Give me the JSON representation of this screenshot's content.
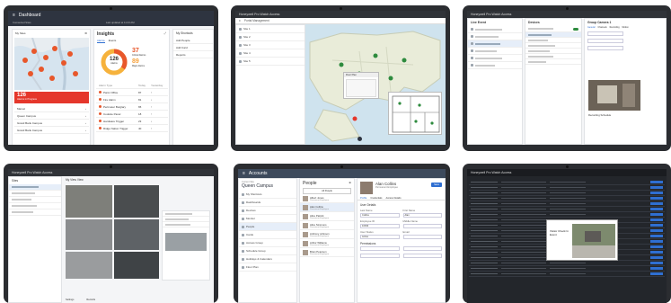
{
  "tablet1": {
    "header_title": "Dashboard",
    "header_sub_left": "Connected Sites",
    "header_sub_center": "Last updated at 11:23 AM",
    "map_title": "My Sites",
    "alert_count": "126",
    "alert_label": "Alarms in Progress",
    "sites": [
      "Marvel",
      "Queen Campus",
      "Grand Bank Campus",
      "Grand Bank Campus"
    ],
    "insights_title": "Insights",
    "insights_tabs": [
      "Alarms",
      "Events"
    ],
    "donut_value": "126",
    "donut_label": "Alarms",
    "stat1_value": "37",
    "stat1_label": "Critical Alarms",
    "stat2_value": "89",
    "stat2_label": "Major Alarms",
    "table_headers": [
      "Alarm Type",
      "Today",
      "Yesterday"
    ],
    "alarm_rows": [
      {
        "name": "Panic Office",
        "today": "87",
        "yest": "↑"
      },
      {
        "name": "Fire Alarm",
        "today": "81",
        "yest": "↓"
      },
      {
        "name": "Perimeter Burglary",
        "today": "65",
        "yest": "↑"
      },
      {
        "name": "Coolsite Panel",
        "today": "18",
        "yest": "↑"
      },
      {
        "name": "Hardware Trigger",
        "today": "23",
        "yest": "↓"
      },
      {
        "name": "Ridge Nation Trigger",
        "today": "40",
        "yest": "↑"
      }
    ],
    "shortcuts_title": "My Shortcuts",
    "shortcuts": [
      "Add People",
      "Add Card",
      "Reports"
    ]
  },
  "tablet2": {
    "app_title": "Honeywell Pro Watch Access",
    "sub_title": "Portal Management",
    "popup_title": "Floor Plan",
    "list_items": [
      "Site 1",
      "Site 2",
      "Site 3",
      "Site 4",
      "Site 5"
    ]
  },
  "tablet3": {
    "app_title": "Honeywell Pro Watch Access",
    "left_title": "Live Event",
    "mid_title": "Devices",
    "right_title": "Group Camera 1",
    "tab_labels": [
      "General",
      "Channels",
      "Recording",
      "Motion"
    ],
    "caption": "Recording Schedule"
  },
  "tablet4": {
    "app_title": "Honeywell Pro Watch Access",
    "left_title": "Sites",
    "main_title": "My View View",
    "footer_labels": [
      "Settings",
      "Records"
    ]
  },
  "tablet5": {
    "header_title": "Accounts",
    "site_label": "Current Site",
    "site_name": "Queen Campus",
    "nav_items": [
      "My Shortcuts",
      "Dashboards",
      "Devices",
      "Monitor",
      "People",
      "Cards",
      "Access Group",
      "Schedule Group",
      "Holidays & Calendars",
      "Floor Plan"
    ],
    "people_title": "People",
    "search_tab": "All People",
    "people": [
      {
        "name": "Albert Jones",
        "role": "Permanent Employee"
      },
      {
        "name": "Alan Collins",
        "role": "Permanent Employee"
      },
      {
        "name": "Alice Patrick",
        "role": "Permanent Employee"
      },
      {
        "name": "Alice Simmons",
        "role": "Permanent Employee"
      },
      {
        "name": "Anthony Johnson",
        "role": "Permanent Employee"
      },
      {
        "name": "Arthur Williams",
        "role": "Permanent Employee"
      },
      {
        "name": "Brian Peterson",
        "role": "Permanent Employee"
      }
    ],
    "profile_name": "Alan Collins",
    "profile_role": "Permanent Employee",
    "profile_tabs": [
      "Profile",
      "Credentials",
      "Access Details"
    ],
    "section1": "User Details",
    "section2": "Permissions",
    "field_labels": [
      "Last Name",
      "First Name",
      "Employee ID",
      "Middle Name",
      "User Status",
      "Email"
    ],
    "field_values": [
      "Collins",
      "Alan",
      "10034",
      "",
      "Active",
      ""
    ],
    "save_label": "Save"
  },
  "tablet6": {
    "app_title": "Honeywell Pro Watch Access",
    "popup_title": "Visitor Check In Event"
  }
}
